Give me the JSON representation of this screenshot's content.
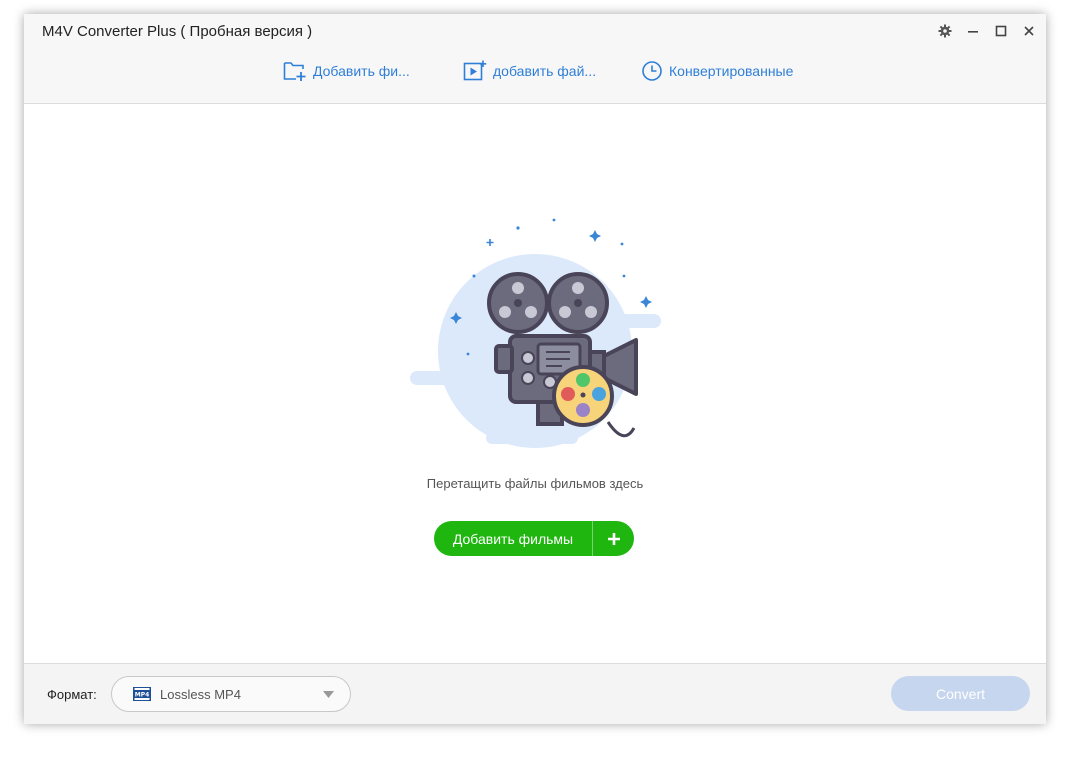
{
  "window": {
    "title": "M4V Converter Plus ( Пробная версия )"
  },
  "window_controls": {
    "settings_icon": "gear-icon",
    "minimize_icon": "minimize-icon",
    "maximize_icon": "maximize-icon",
    "close_icon": "close-icon"
  },
  "toolbar": {
    "add_folder_label": "Добавить фи...",
    "add_file_label": "добавить фай...",
    "converted_label": "Конвертированные",
    "accent_color": "#2f7fd8"
  },
  "main": {
    "illustration_icon": "movie-camera-icon",
    "drop_hint": "Перетащить файлы фильмов здесь",
    "add_movies_label": "Добавить фильмы",
    "add_movies_color": "#1fb60f"
  },
  "footer": {
    "format_label": "Формат:",
    "format_icon_text": "MP4",
    "format_value": "Lossless MP4",
    "convert_label": "Convert",
    "convert_color": "#c6d6ee"
  }
}
